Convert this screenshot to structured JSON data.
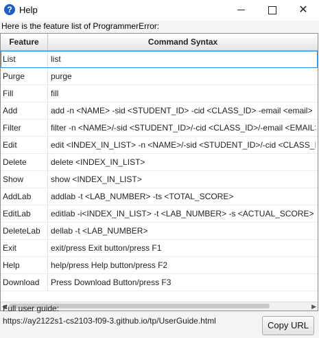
{
  "window": {
    "title": "Help"
  },
  "intro": "Here is the feature list of ProgrammerError:",
  "table": {
    "headers": [
      "Feature",
      "Command Syntax"
    ],
    "rows": [
      [
        "List",
        "list"
      ],
      [
        "Purge",
        "purge"
      ],
      [
        "Fill",
        "fill"
      ],
      [
        "Add",
        "add -n <NAME> -sid <STUDENT_ID> -cid <CLASS_ID> -email <email>"
      ],
      [
        "Filter",
        "filter -n <NAME>/-sid <STUDENT_ID>/-cid <CLASS_ID>/-email <EMAIL>"
      ],
      [
        "Edit",
        "edit <INDEX_IN_LIST> -n <NAME>/-sid <STUDENT_ID>/-cid <CLASS_ID>"
      ],
      [
        "Delete",
        "delete <INDEX_IN_LIST>"
      ],
      [
        "Show",
        "show <INDEX_IN_LIST>"
      ],
      [
        "AddLab",
        "addlab -t <LAB_NUMBER> -ts <TOTAL_SCORE>"
      ],
      [
        "EditLab",
        "editlab -i<INDEX_IN_LIST> -t <LAB_NUMBER> -s <ACTUAL_SCORE>"
      ],
      [
        "DeleteLab",
        "dellab -t <LAB_NUMBER>"
      ],
      [
        "Exit",
        "exit/press Exit button/press F1"
      ],
      [
        "Help",
        "help/press Help button/press F2"
      ],
      [
        "Download",
        "Press Download Button/press F3"
      ]
    ]
  },
  "footer": {
    "guide_label": "Full user guide:",
    "guide_url": "https://ay2122s1-cs2103-f09-3.github.io/tp/UserGuide.html",
    "copy_button": "Copy URL"
  }
}
